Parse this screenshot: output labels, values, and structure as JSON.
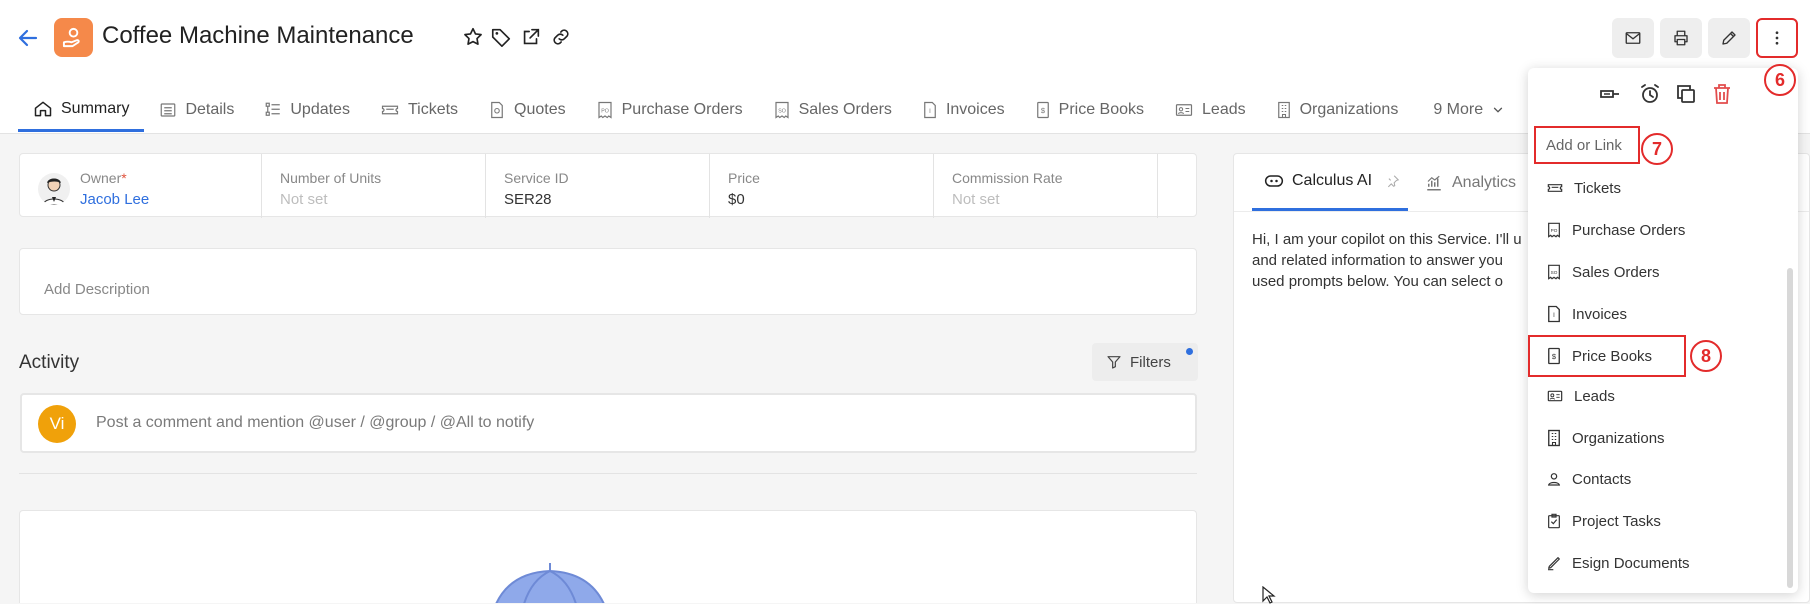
{
  "header": {
    "title": "Coffee Machine Maintenance",
    "icons": [
      "back-arrow-icon",
      "star-icon",
      "tag-icon",
      "external-link-icon",
      "link-icon"
    ],
    "actions": [
      "mail-icon",
      "print-icon",
      "edit-icon",
      "more-vertical-icon"
    ]
  },
  "tabs": [
    {
      "label": "Summary",
      "icon": "home-icon"
    },
    {
      "label": "Details",
      "icon": "list-icon"
    },
    {
      "label": "Updates",
      "icon": "updates-icon"
    },
    {
      "label": "Tickets",
      "icon": "ticket-icon"
    },
    {
      "label": "Quotes",
      "icon": "quote-icon"
    },
    {
      "label": "Purchase Orders",
      "icon": "purchase-order-icon"
    },
    {
      "label": "Sales Orders",
      "icon": "sales-order-icon"
    },
    {
      "label": "Invoices",
      "icon": "invoice-icon"
    },
    {
      "label": "Price Books",
      "icon": "price-book-icon"
    },
    {
      "label": "Leads",
      "icon": "lead-icon"
    },
    {
      "label": "Organizations",
      "icon": "organization-icon"
    }
  ],
  "more_tabs": "9 More",
  "fields": [
    {
      "label": "Owner",
      "required": "*",
      "value": "Jacob Lee"
    },
    {
      "label": "Number of Units",
      "value": "Not set"
    },
    {
      "label": "Service ID",
      "value": "SER28"
    },
    {
      "label": "Price",
      "value": "$0"
    },
    {
      "label": "Commission Rate",
      "value": "Not set"
    }
  ],
  "description_placeholder": "Add Description",
  "activity": {
    "title": "Activity",
    "filters_label": "Filters",
    "avatar_initials": "Vi",
    "comment_placeholder": "Post a comment and mention @user / @group / @All to notify"
  },
  "right_panel": {
    "tabs": [
      {
        "label": "Calculus AI",
        "icon": "ai-bot-icon"
      },
      {
        "label": "Analytics",
        "icon": "analytics-icon"
      }
    ],
    "ai_text": [
      "Hi, I am your copilot on this Service. I'll u",
      "and related information to answer you",
      "used prompts below. You can select o"
    ]
  },
  "menu": {
    "top_icons": [
      "ticket-add-icon",
      "alarm-icon",
      "copy-icon",
      "delete-icon"
    ],
    "header": "Add or Link",
    "items": [
      {
        "label": "Tickets",
        "icon": "ticket-icon"
      },
      {
        "label": "Purchase Orders",
        "icon": "purchase-order-icon"
      },
      {
        "label": "Sales Orders",
        "icon": "sales-order-icon"
      },
      {
        "label": "Invoices",
        "icon": "invoice-icon"
      },
      {
        "label": "Price Books",
        "icon": "price-book-icon"
      },
      {
        "label": "Leads",
        "icon": "lead-icon"
      },
      {
        "label": "Organizations",
        "icon": "organization-icon"
      },
      {
        "label": "Contacts",
        "icon": "contact-icon"
      },
      {
        "label": "Project Tasks",
        "icon": "project-task-icon"
      },
      {
        "label": "Esign Documents",
        "icon": "esign-icon"
      }
    ]
  },
  "badges": [
    "6",
    "7",
    "8"
  ],
  "colors": {
    "accent": "#2f6fde",
    "logo": "#f5894a",
    "highlight": "#e32b2b",
    "avatar": "#f0a10a",
    "delete": "#e24c4c"
  }
}
